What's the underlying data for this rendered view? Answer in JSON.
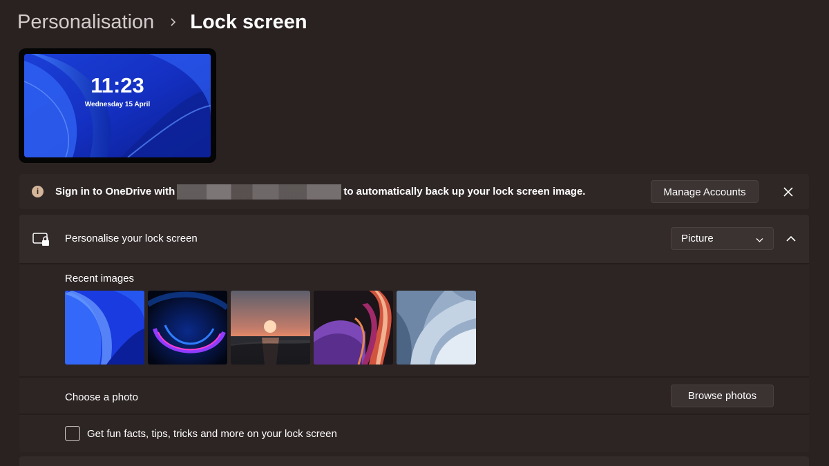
{
  "breadcrumb": {
    "parent": "Personalisation",
    "separator_icon": "chevron-right-icon",
    "current": "Lock screen"
  },
  "preview": {
    "time": "11:23",
    "date": "Wednesday 15 April"
  },
  "infobar": {
    "icon": "info-icon",
    "text_before": "Sign in to OneDrive with",
    "text_after": "to automatically back up your lock screen image.",
    "manage_label": "Manage Accounts",
    "close_icon": "close-icon"
  },
  "personalise": {
    "icon": "lock-screen-icon",
    "label": "Personalise your lock screen",
    "dropdown_value": "Picture",
    "collapse_icon": "chevron-up-icon"
  },
  "recent": {
    "label": "Recent images",
    "thumbnails": [
      "bloom-blue",
      "bloom-dark-purple",
      "sunset-lake",
      "purple-ribbons",
      "light-blue-bloom"
    ]
  },
  "choose_photo": {
    "label": "Choose a photo",
    "button_label": "Browse photos"
  },
  "fun_facts": {
    "label": "Get fun facts, tips, tricks and more on your lock screen",
    "checked": false
  },
  "colors": {
    "background": "#2a2221",
    "card": "#2d2524",
    "card_header": "#332b2a",
    "button": "#3b3332",
    "accent_info": "#d4b59a"
  }
}
